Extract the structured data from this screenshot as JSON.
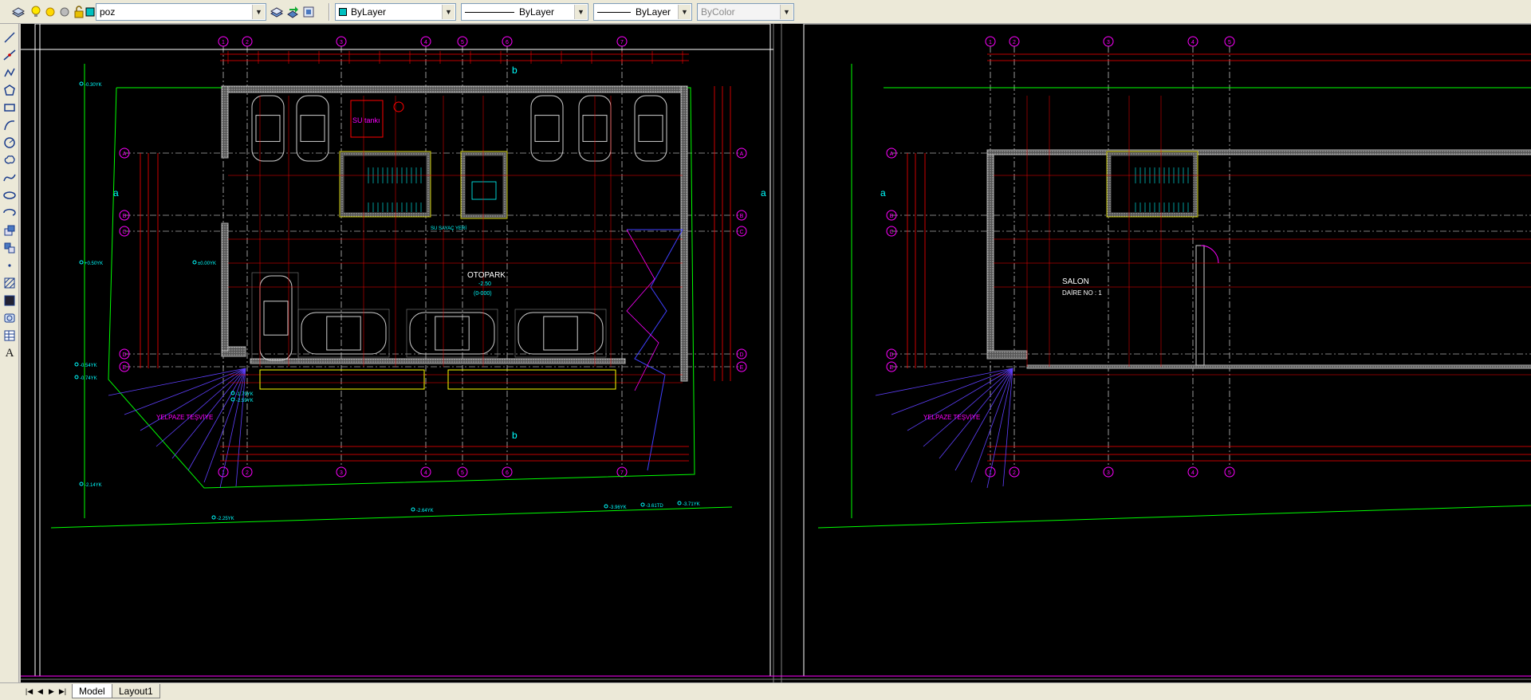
{
  "toolbar": {
    "layer_name": "poz",
    "color_value": "ByLayer",
    "linetype_value": "ByLayer",
    "lineweight_value": "ByLayer",
    "plotstyle_value": "ByColor",
    "icons": [
      "layer-manager-icon",
      "lightbulb-icon",
      "sun-icon",
      "freeze-icon",
      "lock-icon",
      "layer-color-icon",
      "make-current-icon",
      "layer-previous-icon",
      "layer-match-icon"
    ]
  },
  "drawbar": {
    "tools": [
      "line-icon",
      "construction-line-icon",
      "polyline-icon",
      "polygon-icon",
      "rectangle-icon",
      "arc-icon",
      "circle-icon",
      "revision-cloud-icon",
      "spline-icon",
      "ellipse-icon",
      "ellipse-arc-icon",
      "insert-block-icon",
      "make-block-icon",
      "point-icon",
      "hatch-icon",
      "gradient-icon",
      "region-icon",
      "table-icon",
      "multiline-text-icon"
    ],
    "text_tool_label": "A"
  },
  "tabs": {
    "model": "Model",
    "layout1": "Layout1"
  },
  "drawing": {
    "left_plan": {
      "grid_labels_top": [
        "1",
        "2",
        "3",
        "4",
        "5",
        "6",
        "7"
      ],
      "grid_labels_side": [
        "A",
        "B",
        "C",
        "D",
        "E"
      ],
      "room_label": "OTOPARK",
      "room_level": "-2.50",
      "room_level_sub": "(0-000)",
      "water_tank_label": "SU tankı",
      "meter_label": "SU SAYAÇ YERİ",
      "fan_label": "YELPAZE TEŞVİYE",
      "section_mark_a": "a",
      "section_mark_b": "b",
      "elevation_labels": [
        "±0.00YK",
        "+0.50YK",
        "-0.30YK",
        "-0.54YK",
        "-0.74YK",
        "-1.79YK",
        "-2.59YK",
        "-2.14YK",
        "-2.25YK",
        "-2.64YK",
        "-3.96YK",
        "-3.61TD",
        "-3.71YK"
      ]
    },
    "right_plan": {
      "room_label": "SALON",
      "room_sub": "DAİRE NO : 1",
      "fan_label": "YELPAZE TEŞVİYE",
      "section_mark_a": "a",
      "grid_labels_top": [
        "1",
        "2",
        "3",
        "4",
        "5"
      ]
    },
    "colors": {
      "background": "#000000",
      "wall": "#ffffff",
      "dimension": "#ff0000",
      "grid": "#ffffff",
      "cyan": "#00ffff",
      "magenta": "#ff00ff",
      "green": "#00ff00",
      "yellow": "#ffff00",
      "blue": "#4040ff"
    }
  }
}
